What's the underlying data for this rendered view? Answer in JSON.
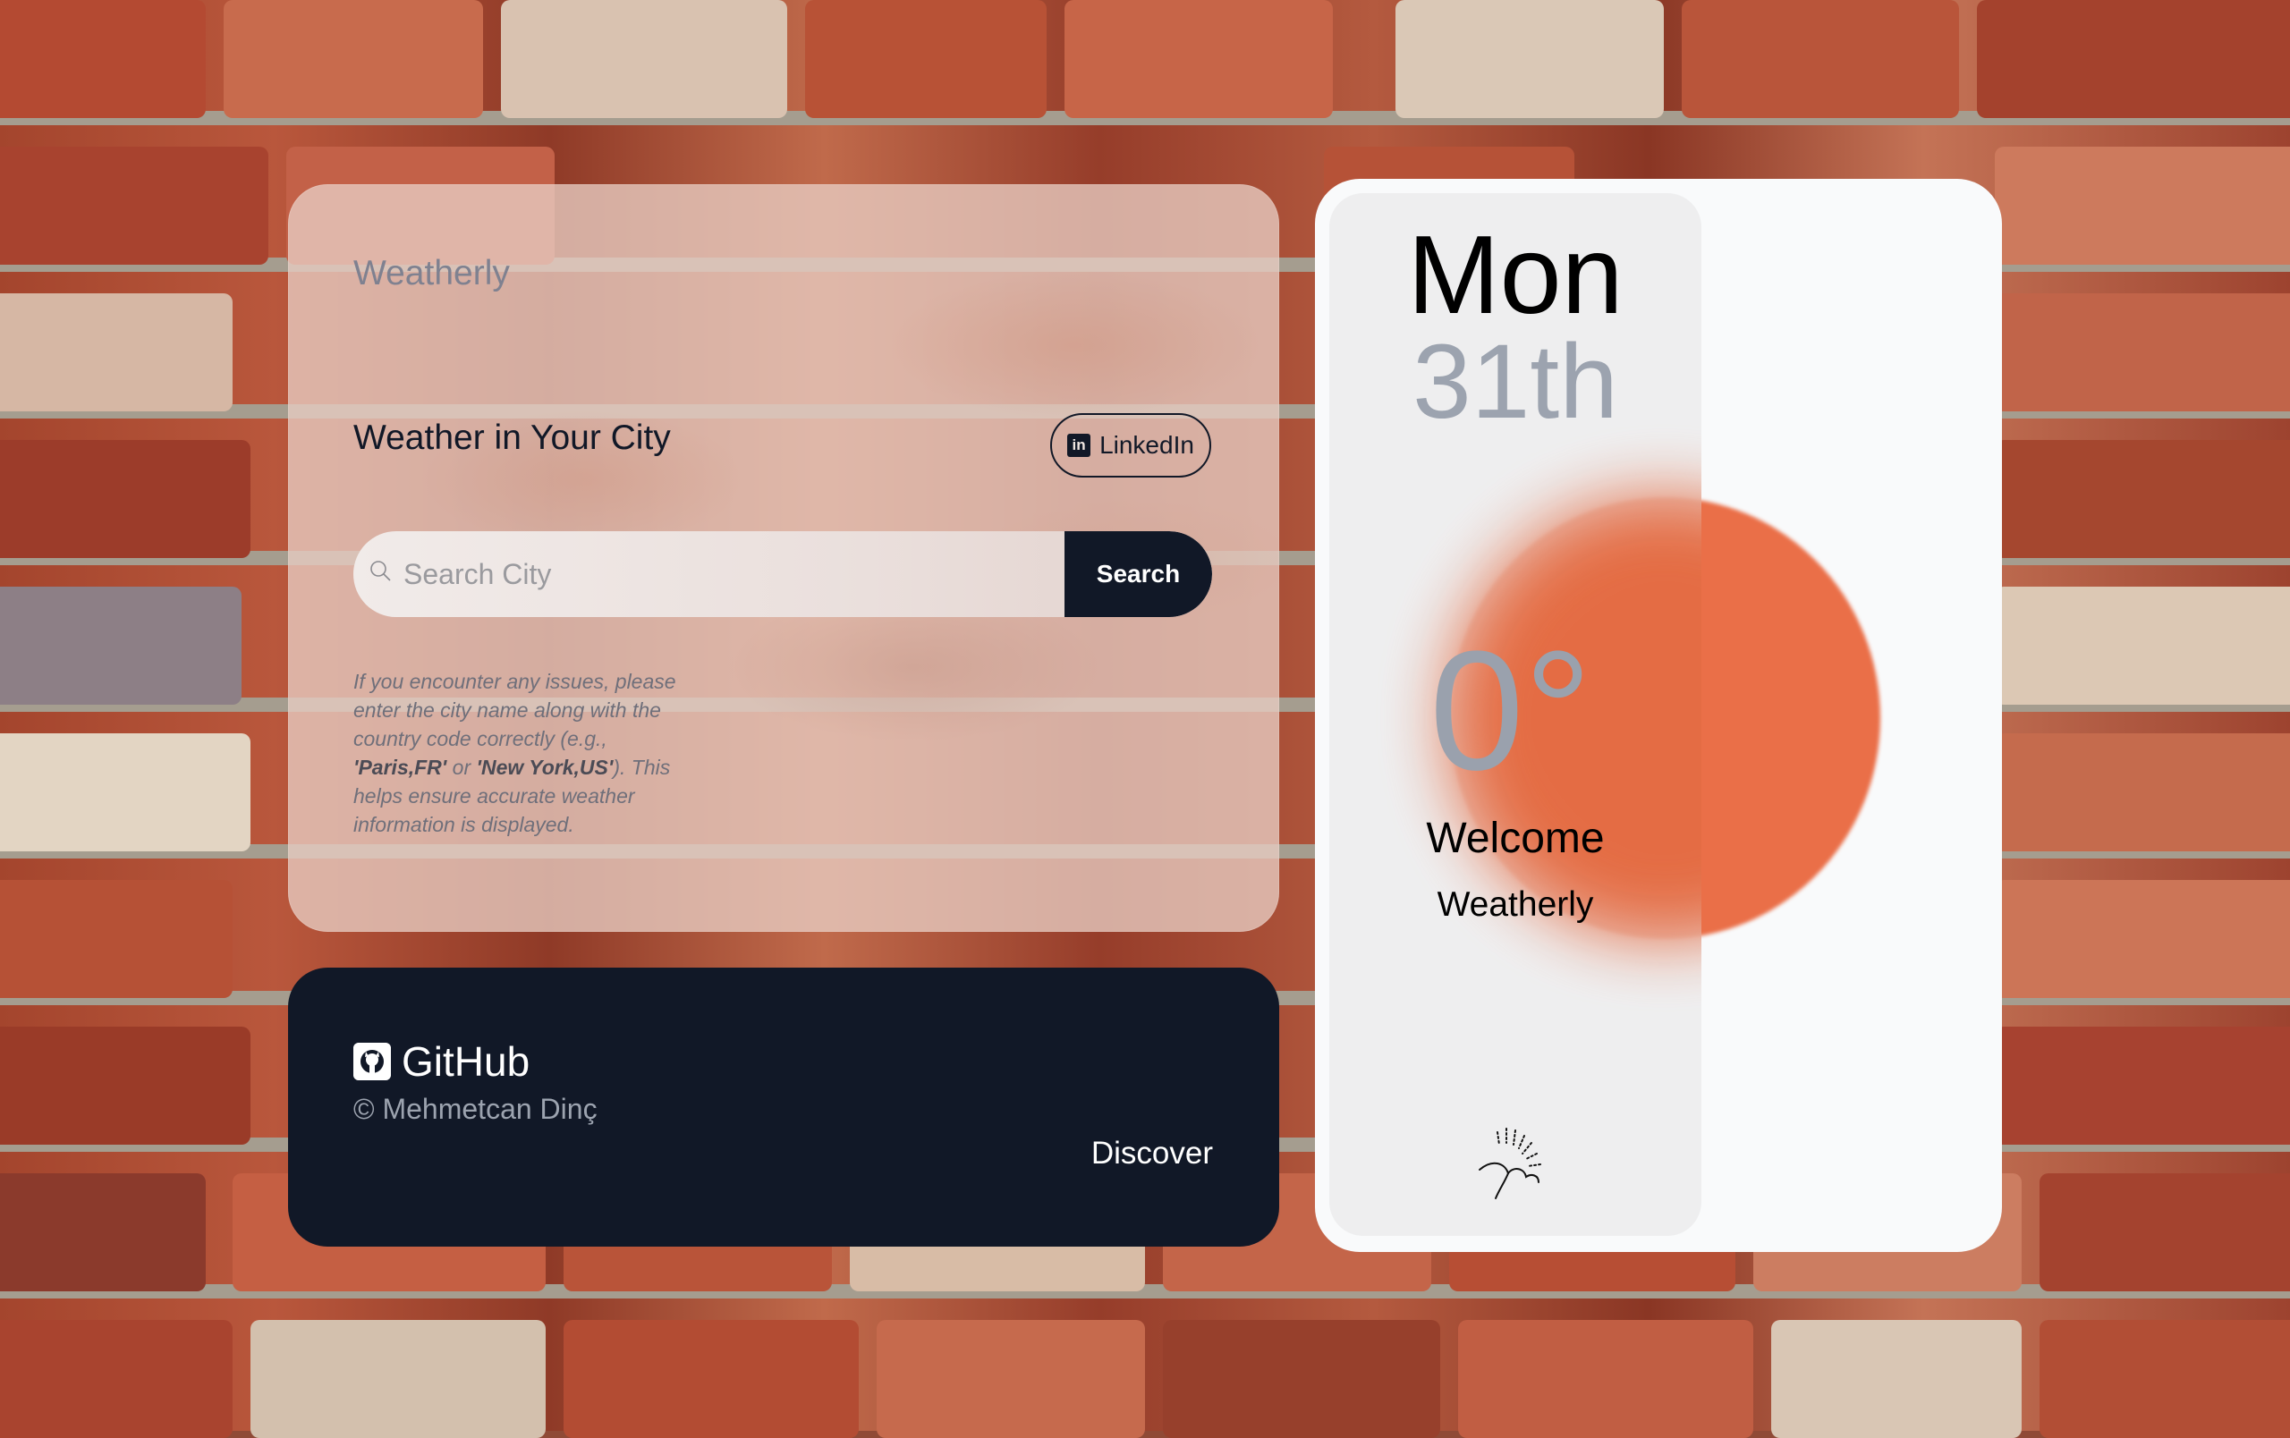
{
  "app": {
    "brand": "Weatherly",
    "headline": "Weather in Your City"
  },
  "linkedin": {
    "label": "LinkedIn",
    "icon": "linkedin-icon"
  },
  "search": {
    "placeholder": "Search City",
    "value": "",
    "button_label": "Search",
    "icon": "search-icon"
  },
  "notice": {
    "part1": "If you encounter any issues, please enter the city name along with the country code correctly (e.g., ",
    "example1": "'Paris,FR'",
    "part2": " or ",
    "example2": "'New York,US'",
    "part3": "). This helps ensure accurate weather information is displayed."
  },
  "footer": {
    "github_label": "GitHub",
    "github_icon": "github-icon",
    "copyright": "© Mehmetcan Dinç",
    "discover_label": "Discover"
  },
  "weather": {
    "day": "Mon",
    "date": "31th",
    "temperature": "0°",
    "welcome": "Welcome",
    "subtitle": "Weatherly",
    "condition_icon": "sunrise-icon"
  },
  "colors": {
    "dark": "#111827",
    "sun": "#ea6f48",
    "muted_gray": "#9ca3af"
  }
}
